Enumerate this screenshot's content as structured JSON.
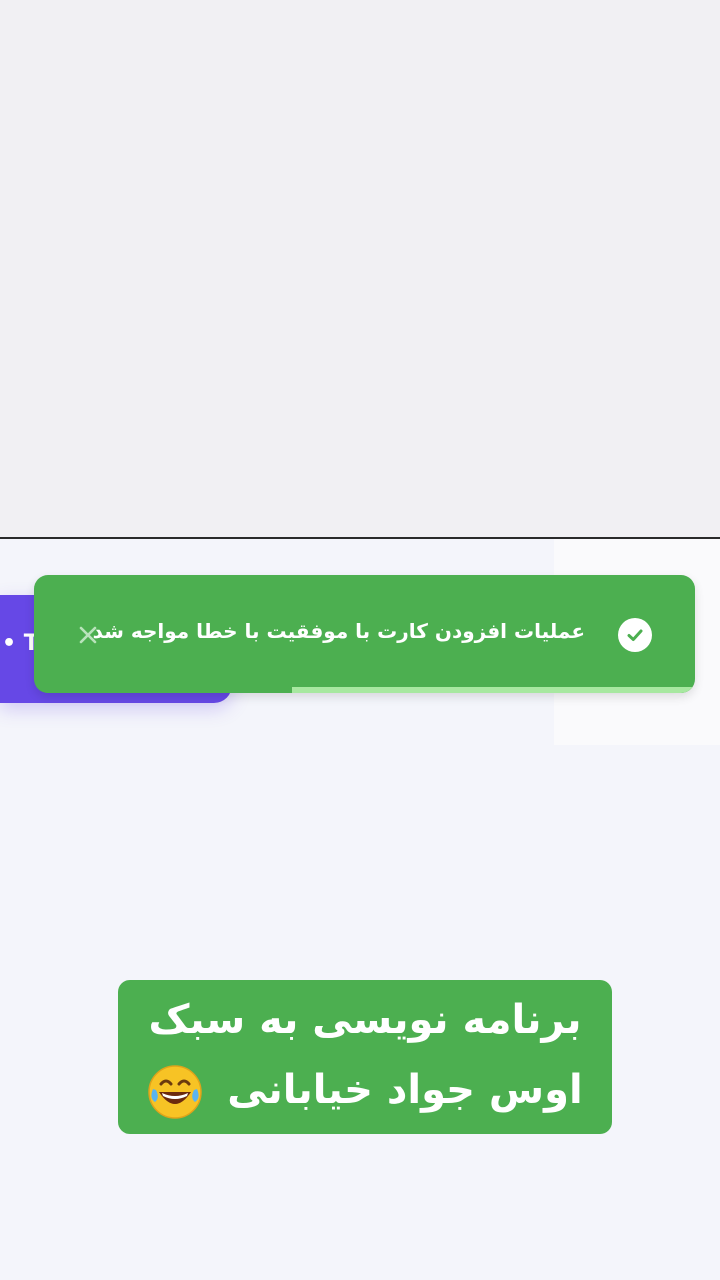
{
  "toast": {
    "message": "عملیات افزودن کارت با موفقیت با خطا مواجه شد",
    "progress": 0.61,
    "color": "#4caf50",
    "progress_color": "#a7e8a0",
    "check_icon": "check-circle-icon",
    "close_icon": "close-icon"
  },
  "background_button": {
    "label": "• T",
    "color": "#6648e6"
  },
  "caption": {
    "line1": "برنامه نویسی به سبک",
    "line2": "اوس جواد خیابانی",
    "emoji": "laughing-tears-emoji",
    "color": "#4caf50"
  }
}
